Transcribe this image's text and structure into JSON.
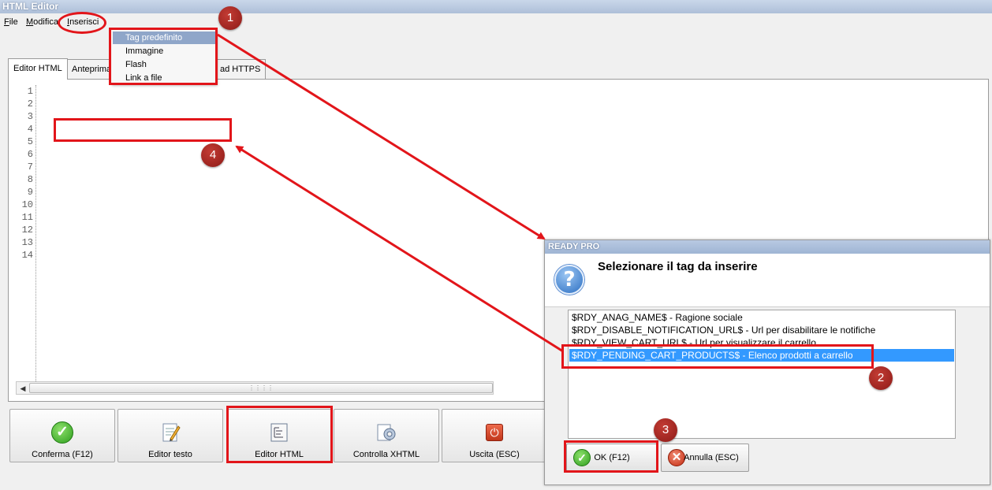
{
  "window": {
    "title": "HTML Editor"
  },
  "menubar": [
    "File",
    "Modifica",
    "Inserisci"
  ],
  "dropdown": {
    "items": [
      {
        "label": "Tag predefinito",
        "selected": true
      },
      {
        "label": "Immagine"
      },
      {
        "label": "Flash"
      },
      {
        "label": "Link a file"
      }
    ]
  },
  "tabs": [
    {
      "label": "Editor HTML",
      "active": true
    },
    {
      "label": "Anteprima"
    },
    {
      "label": "ad HTTPS"
    }
  ],
  "editor": {
    "line_numbers": [
      "1",
      "2",
      "3",
      "4",
      "5",
      "6",
      "7",
      "8",
      "9",
      "10",
      "11",
      "12",
      "13",
      "14"
    ]
  },
  "toolbar": {
    "buttons": [
      {
        "label": "Conferma (F12)",
        "icon": "check-icon"
      },
      {
        "label": "Editor testo",
        "icon": "text-editor-icon"
      },
      {
        "label": "Editor HTML",
        "icon": "html-editor-icon"
      },
      {
        "label": "Controlla XHTML",
        "icon": "xhtml-check-icon"
      },
      {
        "label": "Uscita (ESC)",
        "icon": "exit-icon"
      }
    ]
  },
  "dialog": {
    "title": "READY PRO",
    "heading": "Selezionare il tag da inserire",
    "items": [
      "$RDY_ANAG_NAME$ - Ragione sociale",
      "$RDY_DISABLE_NOTIFICATION_URL$ - Url per disabilitare le notifiche",
      "$RDY_VIEW_CART_URL$ - Url per visualizzare il carrello",
      "$RDY_PENDING_CART_PRODUCTS$ - Elenco prodotti a carrello"
    ],
    "selected_index": 3,
    "ok_label": "OK (F12)",
    "cancel_label": "Annulla (ESC)"
  },
  "annotations": {
    "badges": [
      "1",
      "2",
      "3",
      "4"
    ]
  },
  "colors": {
    "annotation_red": "#e2151a",
    "selection_blue": "#3399ff",
    "tag_color": "#00008b",
    "attr_color": "#8b0000"
  }
}
